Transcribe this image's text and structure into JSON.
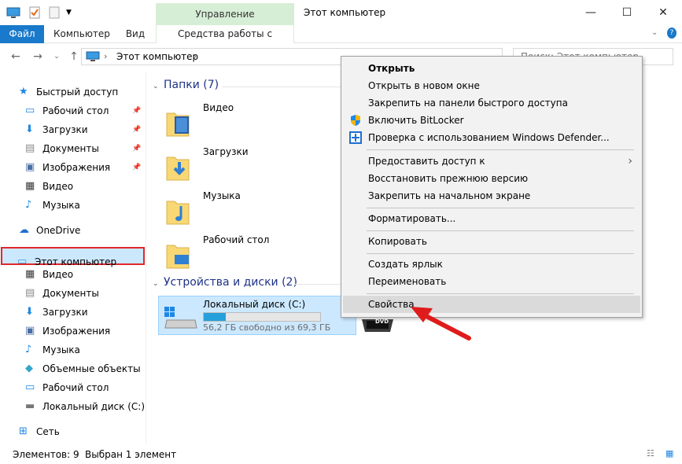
{
  "titlebar": {
    "title": "Этот компьютер",
    "manage_tab": "Управление"
  },
  "ribbon": {
    "tabs": [
      "Файл",
      "Компьютер",
      "Вид",
      "Средства работы с дисками"
    ]
  },
  "address": {
    "path": "Этот компьютер",
    "search_placeholder": "Поиск: Этот компьютер"
  },
  "sidebar": {
    "items": [
      {
        "label": "Быстрый доступ",
        "icon": "star-icon"
      },
      {
        "label": "Рабочий стол",
        "icon": "desktop-icon"
      },
      {
        "label": "Загрузки",
        "icon": "downloads-icon"
      },
      {
        "label": "Документы",
        "icon": "documents-icon"
      },
      {
        "label": "Изображения",
        "icon": "pictures-icon"
      },
      {
        "label": "Видео",
        "icon": "video-icon"
      },
      {
        "label": "Музыка",
        "icon": "music-icon"
      },
      {
        "label": "OneDrive",
        "icon": "cloud-icon"
      },
      {
        "label": "Этот компьютер",
        "icon": "computer-icon"
      },
      {
        "label": "Видео",
        "icon": "video-icon"
      },
      {
        "label": "Документы",
        "icon": "documents-icon"
      },
      {
        "label": "Загрузки",
        "icon": "downloads-icon"
      },
      {
        "label": "Изображения",
        "icon": "pictures-icon"
      },
      {
        "label": "Музыка",
        "icon": "music-icon"
      },
      {
        "label": "Объемные объекты",
        "icon": "3d-objects-icon"
      },
      {
        "label": "Рабочий стол",
        "icon": "desktop-icon"
      },
      {
        "label": "Локальный диск (C:)",
        "icon": "drive-icon"
      },
      {
        "label": "Сеть",
        "icon": "network-icon"
      }
    ]
  },
  "main": {
    "folders_header": "Папки (7)",
    "folders": [
      "Видео",
      "Загрузки",
      "Музыка",
      "Рабочий стол"
    ],
    "devices_header": "Устройства и диски (2)",
    "drive": {
      "name": "Локальный диск (C:)",
      "free": "56,2 ГБ свободно из 69,3 ГБ",
      "used_fraction": 0.19
    },
    "dvd_label": "DVD"
  },
  "context_menu": {
    "items": [
      "Открыть",
      "Открыть в новом окне",
      "Закрепить на панели быстрого доступа",
      "Включить BitLocker",
      "Проверка с использованием Windows Defender...",
      "Предоставить доступ к",
      "Восстановить прежнюю версию",
      "Закрепить на начальном экране",
      "Форматировать...",
      "Копировать",
      "Создать ярлык",
      "Переименовать",
      "Свойства"
    ]
  },
  "status": {
    "items_count": "Элементов: 9",
    "selected": "Выбран 1 элемент"
  },
  "colors": {
    "accent": "#1979ca",
    "selection": "#cce8ff",
    "highlight_border": "#e0262b",
    "arrow": "#e01b1b"
  }
}
